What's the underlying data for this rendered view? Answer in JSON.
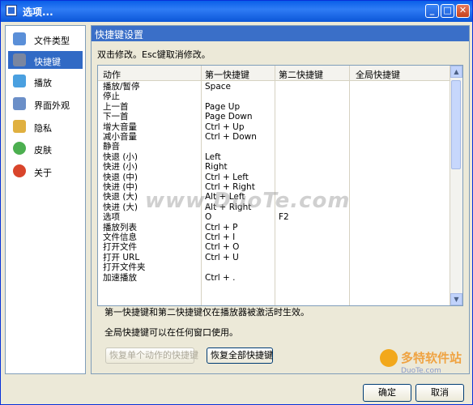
{
  "window": {
    "title": "选项..."
  },
  "titlebar_buttons": {
    "min": "_",
    "max": "□",
    "close": "✕"
  },
  "sidebar": {
    "items": [
      {
        "label": "文件类型",
        "icon": "file-type-icon",
        "color": "#5a8fd8",
        "active": false
      },
      {
        "label": "快捷键",
        "icon": "tools-icon",
        "color": "#7a86a0",
        "active": true
      },
      {
        "label": "播放",
        "icon": "monitor-icon",
        "color": "#4aa0e0",
        "active": false
      },
      {
        "label": "界面外观",
        "icon": "window-icon",
        "color": "#6b8fc8",
        "active": false
      },
      {
        "label": "隐私",
        "icon": "lock-icon",
        "color": "#e0b040",
        "active": false
      },
      {
        "label": "皮肤",
        "icon": "users-icon",
        "color": "#4caf50",
        "active": false
      },
      {
        "label": "关于",
        "icon": "help-icon",
        "color": "#d9452b",
        "active": false
      }
    ]
  },
  "panel": {
    "title": "快捷键设置",
    "hint": "双击修改。Esc键取消修改。"
  },
  "table": {
    "headers": [
      "动作",
      "第一快捷键",
      "第二快捷键",
      "全局快捷键"
    ],
    "rows": [
      [
        "播放/暂停",
        "Space",
        "",
        ""
      ],
      [
        "停止",
        "",
        "",
        ""
      ],
      [
        "上一首",
        "Page Up",
        "",
        ""
      ],
      [
        "下一首",
        "Page Down",
        "",
        ""
      ],
      [
        "增大音量",
        "Ctrl + Up",
        "",
        ""
      ],
      [
        "减小音量",
        "Ctrl + Down",
        "",
        ""
      ],
      [
        "静音",
        "",
        "",
        ""
      ],
      [
        "快退 (小)",
        "Left",
        "",
        ""
      ],
      [
        "快进 (小)",
        "Right",
        "",
        ""
      ],
      [
        "快退 (中)",
        "Ctrl + Left",
        "",
        ""
      ],
      [
        "快进 (中)",
        "Ctrl + Right",
        "",
        ""
      ],
      [
        "快退 (大)",
        "Alt + Left",
        "",
        ""
      ],
      [
        "快进 (大)",
        "Alt + Right",
        "",
        ""
      ],
      [
        "选项",
        "O",
        "F2",
        ""
      ],
      [
        "播放列表",
        "Ctrl + P",
        "",
        ""
      ],
      [
        "文件信息",
        "Ctrl + I",
        "",
        ""
      ],
      [
        "打开文件",
        "Ctrl + O",
        "",
        ""
      ],
      [
        "打开 URL",
        "Ctrl + U",
        "",
        ""
      ],
      [
        "打开文件夹",
        "",
        "",
        ""
      ],
      [
        "加速播放",
        "Ctrl + .",
        "",
        ""
      ]
    ]
  },
  "notes": {
    "line1": "第一快捷键和第二快捷键仅在播放器被激活时生效。",
    "line2": "全局快捷键可以在任何窗口使用。"
  },
  "buttons": {
    "restore_single": "恢复单个动作的快捷键",
    "restore_all": "恢复全部快捷键",
    "ok": "确定",
    "cancel": "取消"
  },
  "watermark": {
    "text": "www.DuoTe.com",
    "logo": "多特软件站",
    "logo_url": "DuoTe.com"
  },
  "colors": {
    "selection": "#316ac5",
    "titlebar": "#0a5fe8",
    "panel_header": "#3a6fc8"
  }
}
